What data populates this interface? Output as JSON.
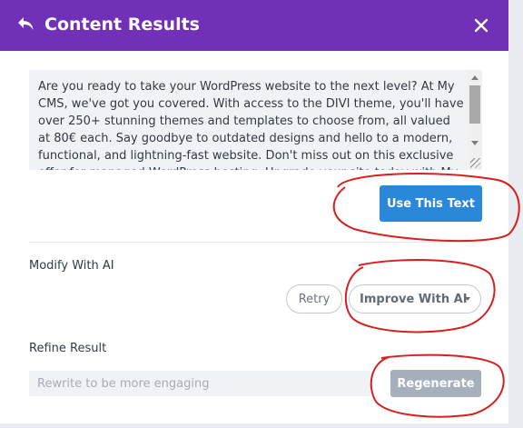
{
  "header": {
    "title": "Content Results",
    "back_icon": "back-arrow-icon",
    "close_icon": "close-icon",
    "background": "#7030b8"
  },
  "result": {
    "text": "Are you ready to take your WordPress website to the next level? At My CMS, we've got you covered. With access to the DIVI theme, you'll have over 250+ stunning themes and templates to choose from, all valued at 80€ each. Say goodbye to outdated designs and hello to a modern, functional, and lightning-fast website. Don't miss out on this exclusive offer for managed WordPress hosting. Upgrade your site today with My CMS!",
    "use_button_label": "Use This Text",
    "use_button_color": "#2b87da"
  },
  "modify": {
    "label": "Modify With AI",
    "retry_label": "Retry",
    "improve_label": "Improve With AI"
  },
  "refine": {
    "label": "Refine Result",
    "placeholder": "Rewrite to be more engaging",
    "value": "",
    "regenerate_label": "Regenerate",
    "regenerate_color": "#a6b0bd"
  },
  "annotation_color": "#d81e1e"
}
